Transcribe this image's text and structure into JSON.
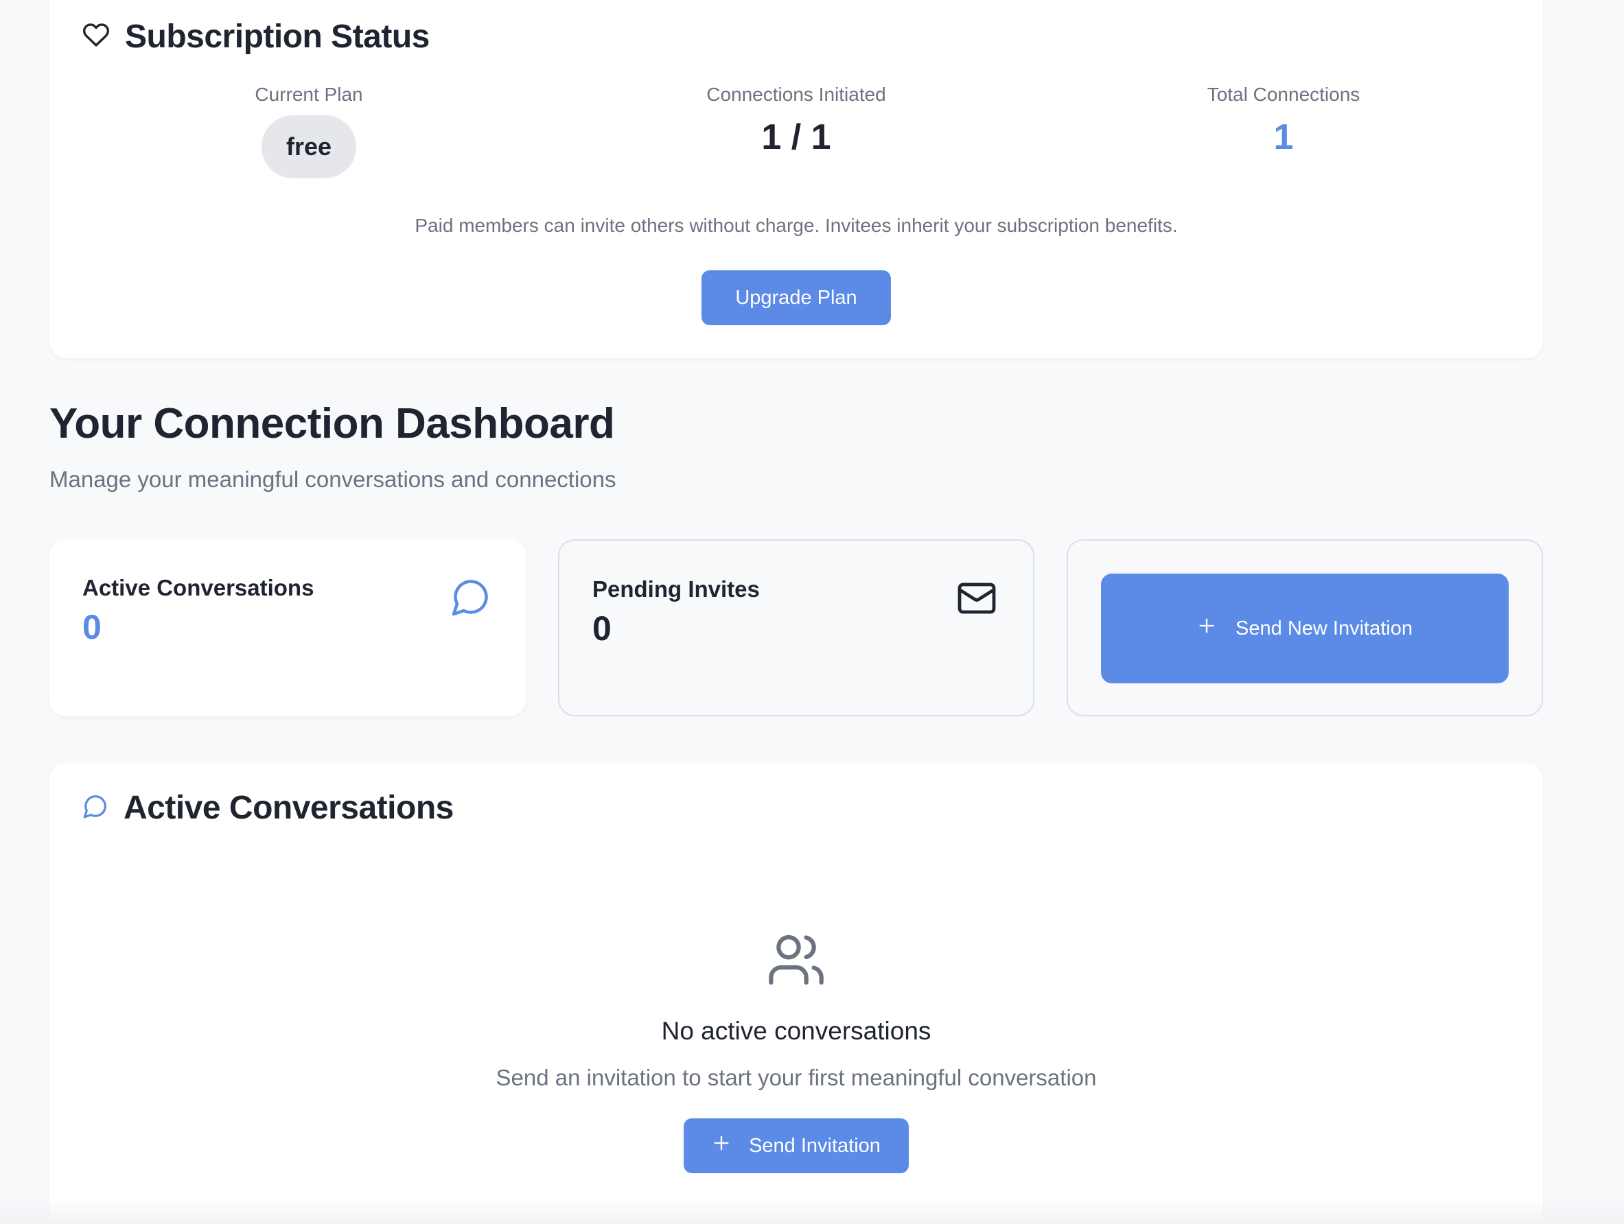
{
  "subscription": {
    "title": "Subscription Status",
    "icon": "heart-icon",
    "current_plan_label": "Current Plan",
    "current_plan_value": "free",
    "connections_initiated_label": "Connections Initiated",
    "connections_initiated_value": "1 / 1",
    "total_connections_label": "Total Connections",
    "total_connections_value": "1",
    "note": "Paid members can invite others without charge. Invitees inherit your subscription benefits.",
    "upgrade_label": "Upgrade Plan"
  },
  "dashboard": {
    "title": "Your Connection Dashboard",
    "subtitle": "Manage your meaningful conversations and connections"
  },
  "stats": {
    "active_conversations_label": "Active Conversations",
    "active_conversations_value": "0",
    "active_icon": "chat-bubble-icon",
    "pending_invites_label": "Pending Invites",
    "pending_invites_value": "0",
    "pending_icon": "envelope-icon",
    "send_new_label": "Send New Invitation",
    "send_new_icon": "plus-icon"
  },
  "conversations": {
    "title": "Active Conversations",
    "icon": "chat-bubble-icon",
    "empty_icon": "users-icon",
    "empty_title": "No active conversations",
    "empty_subtitle": "Send an invitation to start your first meaningful conversation",
    "send_label": "Send Invitation",
    "send_icon": "plus-icon"
  },
  "colors": {
    "accent": "#5b8be6",
    "accent_text": "#5b8be3",
    "background": "#f8f9fb",
    "card": "#ffffff",
    "muted_text": "#6b7280",
    "plan_pill": "#e5e7eb"
  }
}
